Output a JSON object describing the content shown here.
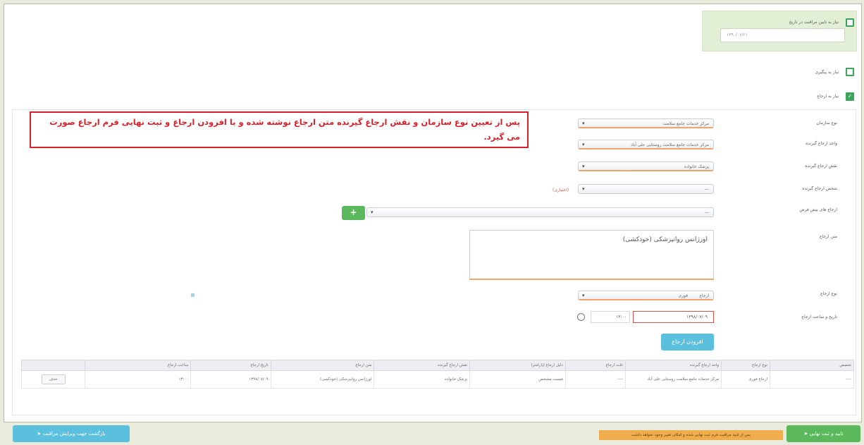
{
  "top_panel": {
    "checkbox_label": "نیاز به تایین مراقبت در تاریخ",
    "date_value": "۱۳۹۰/۰۷/۲۱"
  },
  "options": {
    "disease_label": "نیاز به پیگیری",
    "referral_label": "نیاز به ارجاع"
  },
  "form": {
    "org_type_label": "نوع سازمان",
    "org_type_value": "مرکز خدمات جامع سلامت",
    "receiver_unit_label": "واحد ارجاع گیرنده",
    "receiver_unit_value": "مرکز خدمات جامع سلامت روستایی علی آباد",
    "receiver_role_label": "نقش ارجاع گیرنده",
    "receiver_role_value": "پزشک خانواده",
    "receiver_person_label": "شخص ارجاع گیرنده",
    "receiver_person_value": "---",
    "receiver_person_hint": "(اختیاری)",
    "preset_label": "ارجاع های پیش فرض",
    "preset_value": "---",
    "text_label": "متن ارجاع",
    "text_value": "اورژانس روانپزشکی (خودکشی)",
    "type_label": "نوع ارجاع",
    "type_value_a": "ارجاع",
    "type_value_b": "فوری",
    "datetime_label": "تاریخ و ساعت ارجاع",
    "date_value": "۱۳۹۸/۰۷/۰۹",
    "time_value": "۱۳:۰۰",
    "add_button": "افزودن ارجاع"
  },
  "callout": "پس از تعیین نوع سازمان و نقش ارجاع گیرنده متن ارجاع نوشته شده و با افزودن ارجاع و ثبت نهایی فرم ارجاع صورت می گیرد.",
  "table": {
    "headers": [
      "تخصص",
      "نوع ارجاع",
      "واحد ارجاع گیرنده",
      "علت ارجاع",
      "دلیل ارجاع (پارامتر)",
      "نقش ارجاع گیرنده",
      "متن ارجاع",
      "تاریخ ارجاع",
      "ساعت ارجاع",
      ""
    ],
    "row": [
      "----",
      "ارجاع فوری",
      "مرکز خدمات جامع سلامت روستایی علی آباد",
      "----",
      "فیست مشخص",
      "پزشک خانواده",
      "اورژانس روانپزشکی (خودکشی)",
      "۱۳۹۸/۰۷/۰۹",
      "۱۳:۰۰",
      "حذف"
    ]
  },
  "footer": {
    "back_button": "بازگشت جهت ویرایش مراقبت",
    "submit_button": "تایید و ثبت نهایی",
    "warning": "پس از تایید مراقبت فرم ثبت نهایی شده و امکان تغییر وجود نخواهد داشت"
  },
  "colors": {
    "green": "#5cb85c",
    "blue": "#5bc0de",
    "red": "#d9202a",
    "warning": "#f0ad4e"
  }
}
